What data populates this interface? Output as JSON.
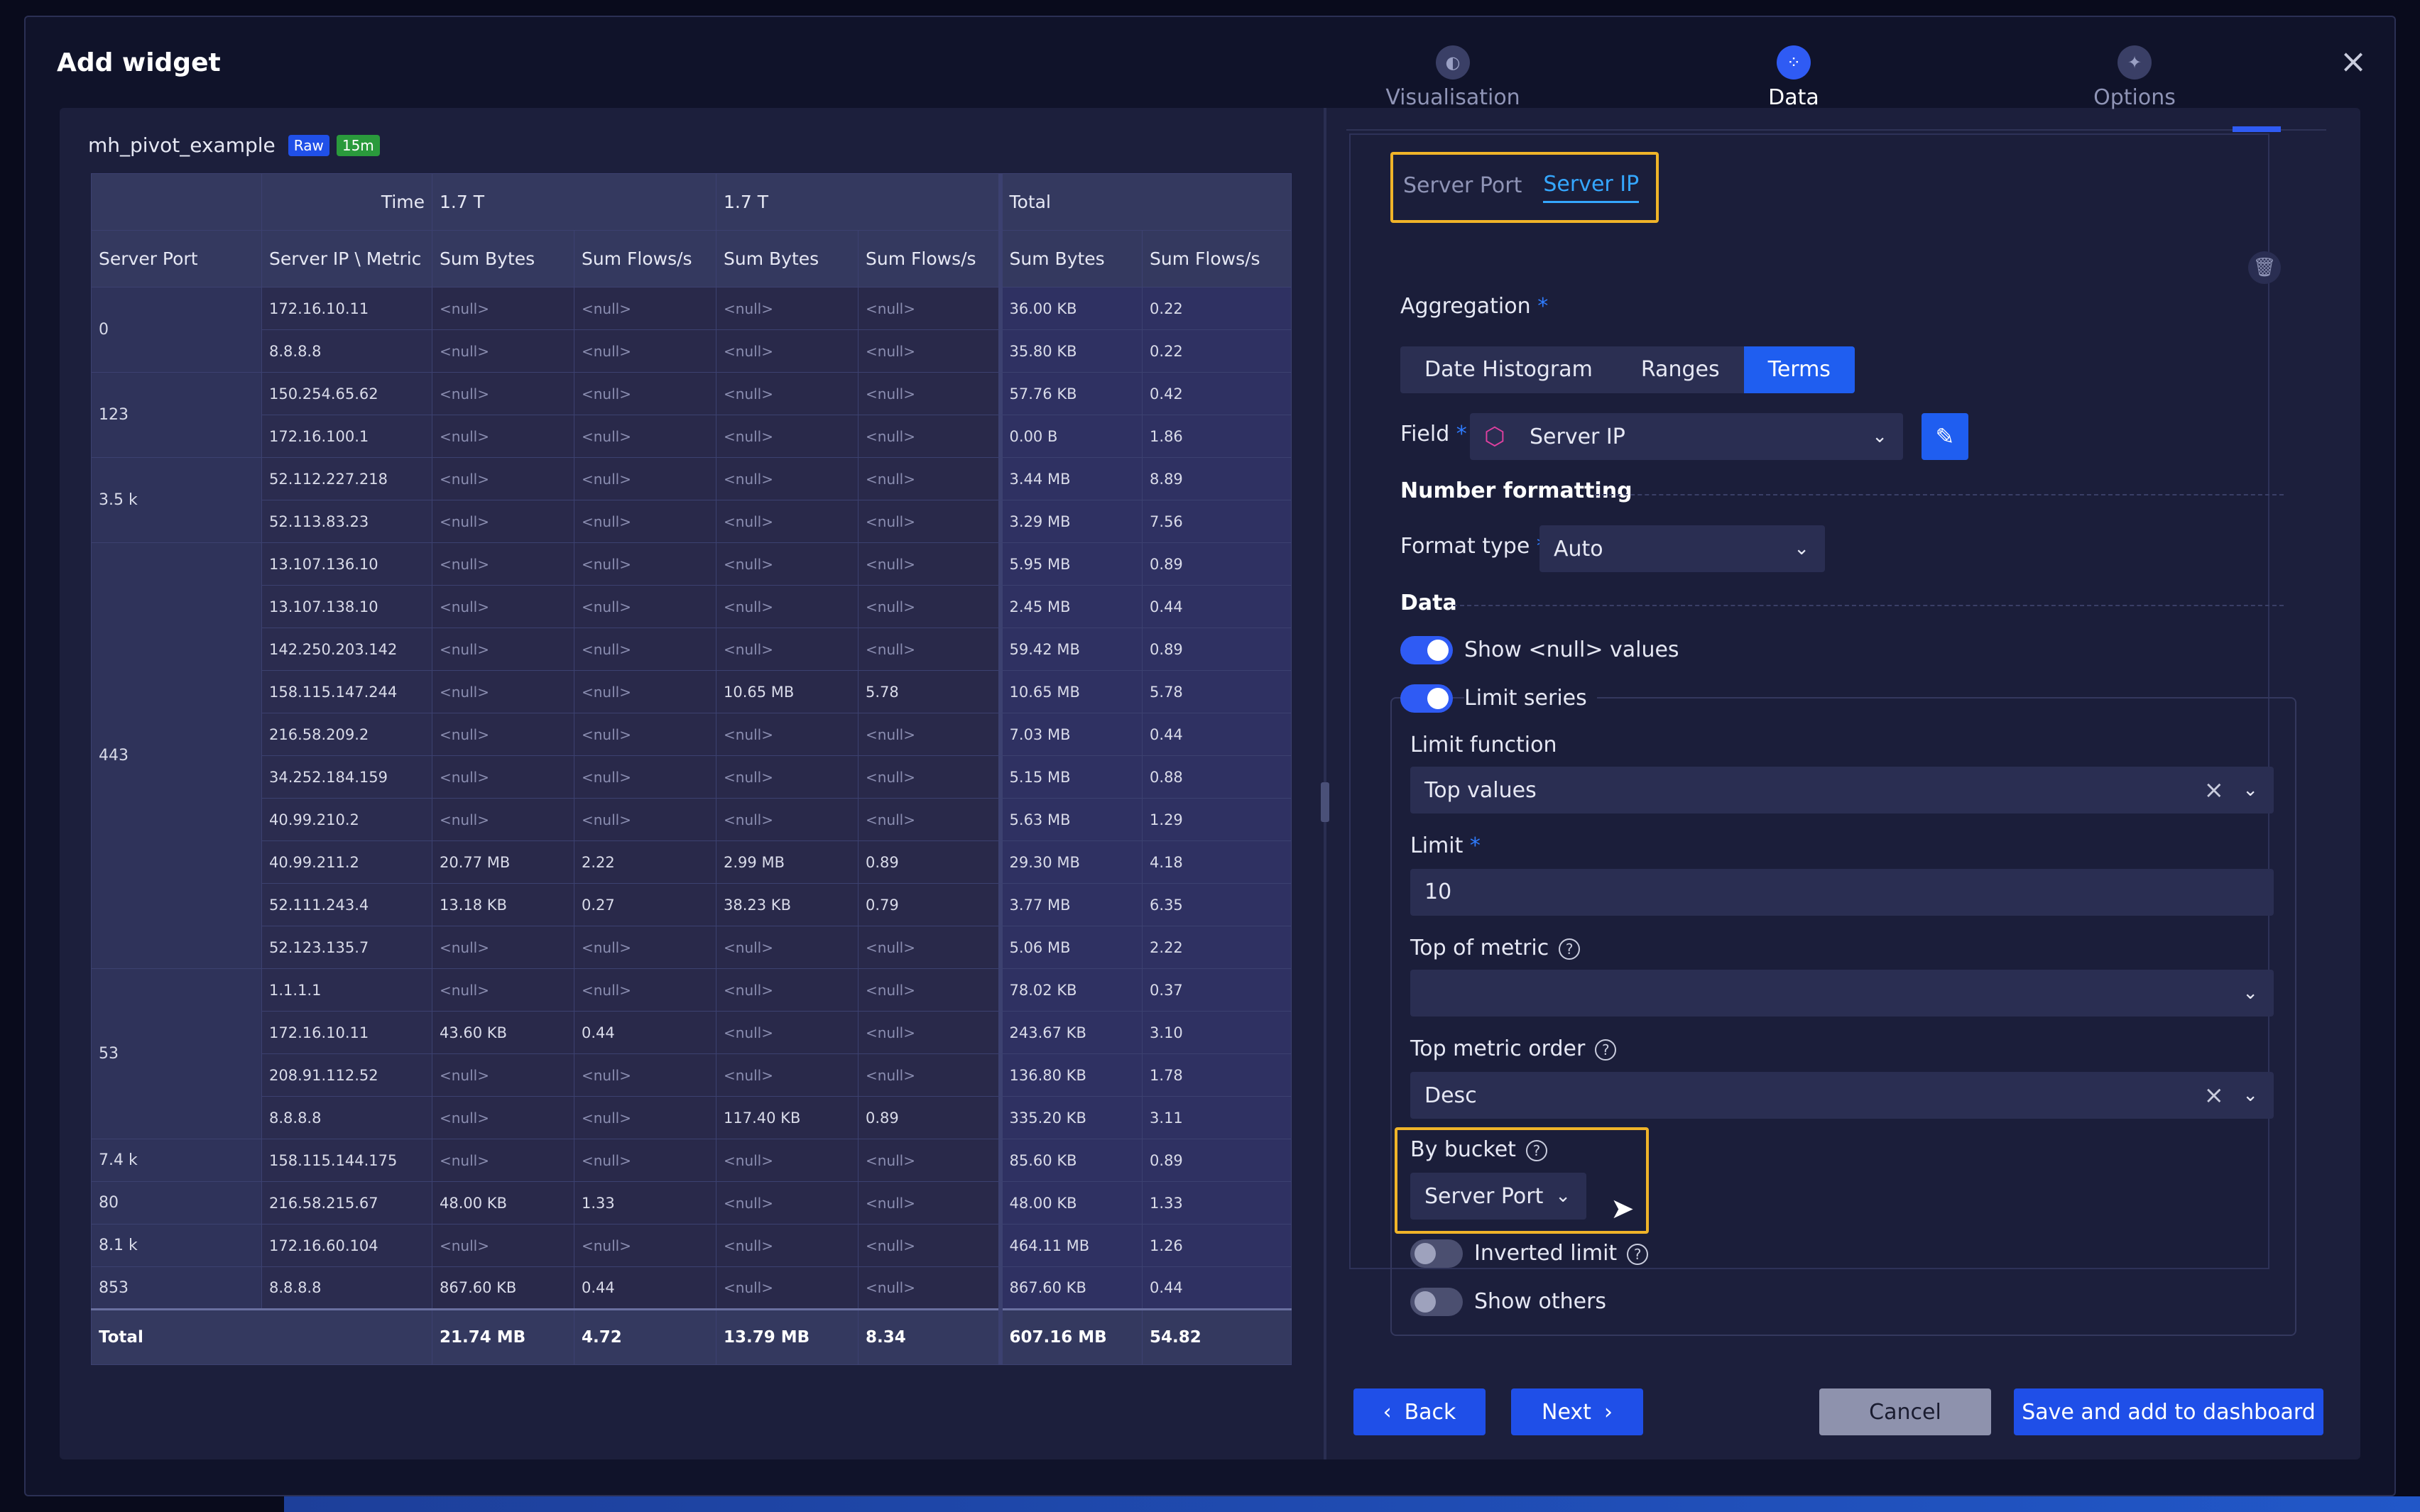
{
  "dialog": {
    "title": "Add widget",
    "close_icon": "close-icon"
  },
  "query": {
    "name": "mh_pivot_example",
    "badges": [
      "Raw",
      "15m"
    ]
  },
  "pivot": {
    "header_top": {
      "time_label": "Time",
      "groups": [
        "1.7 T",
        "1.7 T",
        "Total"
      ]
    },
    "header_cols": {
      "server_port": "Server Port",
      "server_ip_metric": "Server IP  \\  Metric",
      "metrics": [
        "Sum Bytes",
        "Sum Flows/s",
        "Sum Bytes",
        "Sum Flows/s",
        "Sum Bytes",
        "Sum Flows/s"
      ]
    },
    "groups": [
      {
        "port": "0",
        "rows": [
          {
            "ip": "172.16.10.11",
            "v": [
              "<null>",
              "<null>",
              "<null>",
              "<null>",
              "36.00 KB",
              "0.22"
            ]
          },
          {
            "ip": "8.8.8.8",
            "v": [
              "<null>",
              "<null>",
              "<null>",
              "<null>",
              "35.80 KB",
              "0.22"
            ]
          }
        ]
      },
      {
        "port": "123",
        "rows": [
          {
            "ip": "150.254.65.62",
            "v": [
              "<null>",
              "<null>",
              "<null>",
              "<null>",
              "57.76 KB",
              "0.42"
            ]
          },
          {
            "ip": "172.16.100.1",
            "v": [
              "<null>",
              "<null>",
              "<null>",
              "<null>",
              "0.00 B",
              "1.86"
            ]
          }
        ]
      },
      {
        "port": "3.5 k",
        "rows": [
          {
            "ip": "52.112.227.218",
            "v": [
              "<null>",
              "<null>",
              "<null>",
              "<null>",
              "3.44 MB",
              "8.89"
            ]
          },
          {
            "ip": "52.113.83.23",
            "v": [
              "<null>",
              "<null>",
              "<null>",
              "<null>",
              "3.29 MB",
              "7.56"
            ]
          }
        ]
      },
      {
        "port": "443",
        "rows": [
          {
            "ip": "13.107.136.10",
            "v": [
              "<null>",
              "<null>",
              "<null>",
              "<null>",
              "5.95 MB",
              "0.89"
            ]
          },
          {
            "ip": "13.107.138.10",
            "v": [
              "<null>",
              "<null>",
              "<null>",
              "<null>",
              "2.45 MB",
              "0.44"
            ]
          },
          {
            "ip": "142.250.203.142",
            "v": [
              "<null>",
              "<null>",
              "<null>",
              "<null>",
              "59.42 MB",
              "0.89"
            ]
          },
          {
            "ip": "158.115.147.244",
            "v": [
              "<null>",
              "<null>",
              "10.65 MB",
              "5.78",
              "10.65 MB",
              "5.78"
            ]
          },
          {
            "ip": "216.58.209.2",
            "v": [
              "<null>",
              "<null>",
              "<null>",
              "<null>",
              "7.03 MB",
              "0.44"
            ]
          },
          {
            "ip": "34.252.184.159",
            "v": [
              "<null>",
              "<null>",
              "<null>",
              "<null>",
              "5.15 MB",
              "0.88"
            ]
          },
          {
            "ip": "40.99.210.2",
            "v": [
              "<null>",
              "<null>",
              "<null>",
              "<null>",
              "5.63 MB",
              "1.29"
            ]
          },
          {
            "ip": "40.99.211.2",
            "v": [
              "20.77 MB",
              "2.22",
              "2.99 MB",
              "0.89",
              "29.30 MB",
              "4.18"
            ]
          },
          {
            "ip": "52.111.243.4",
            "v": [
              "13.18 KB",
              "0.27",
              "38.23 KB",
              "0.79",
              "3.77 MB",
              "6.35"
            ]
          },
          {
            "ip": "52.123.135.7",
            "v": [
              "<null>",
              "<null>",
              "<null>",
              "<null>",
              "5.06 MB",
              "2.22"
            ]
          }
        ]
      },
      {
        "port": "53",
        "rows": [
          {
            "ip": "1.1.1.1",
            "v": [
              "<null>",
              "<null>",
              "<null>",
              "<null>",
              "78.02 KB",
              "0.37"
            ]
          },
          {
            "ip": "172.16.10.11",
            "v": [
              "43.60 KB",
              "0.44",
              "<null>",
              "<null>",
              "243.67 KB",
              "3.10"
            ]
          },
          {
            "ip": "208.91.112.52",
            "v": [
              "<null>",
              "<null>",
              "<null>",
              "<null>",
              "136.80 KB",
              "1.78"
            ]
          },
          {
            "ip": "8.8.8.8",
            "v": [
              "<null>",
              "<null>",
              "117.40 KB",
              "0.89",
              "335.20 KB",
              "3.11"
            ]
          }
        ]
      },
      {
        "port": "7.4 k",
        "rows": [
          {
            "ip": "158.115.144.175",
            "v": [
              "<null>",
              "<null>",
              "<null>",
              "<null>",
              "85.60 KB",
              "0.89"
            ]
          }
        ]
      },
      {
        "port": "80",
        "rows": [
          {
            "ip": "216.58.215.67",
            "v": [
              "48.00 KB",
              "1.33",
              "<null>",
              "<null>",
              "48.00 KB",
              "1.33"
            ]
          }
        ]
      },
      {
        "port": "8.1 k",
        "rows": [
          {
            "ip": "172.16.60.104",
            "v": [
              "<null>",
              "<null>",
              "<null>",
              "<null>",
              "464.11 MB",
              "1.26"
            ]
          }
        ]
      },
      {
        "port": "853",
        "rows": [
          {
            "ip": "8.8.8.8",
            "v": [
              "867.60 KB",
              "0.44",
              "<null>",
              "<null>",
              "867.60 KB",
              "0.44"
            ]
          }
        ]
      }
    ],
    "total": {
      "label": "Total",
      "v": [
        "21.74 MB",
        "4.72",
        "13.79 MB",
        "8.34",
        "607.16 MB",
        "54.82"
      ]
    }
  },
  "wizard": {
    "tabs": [
      {
        "label": "Visualisation",
        "icon": "palette-icon"
      },
      {
        "label": "Data",
        "icon": "grid-icon"
      },
      {
        "label": "Options",
        "icon": "sparkle-icon"
      }
    ],
    "active_tab": "Data"
  },
  "bucket_chips": [
    "Server Port",
    "Server IP"
  ],
  "form": {
    "aggregation_label": "Aggregation",
    "aggregation_options": [
      "Date Histogram",
      "Ranges",
      "Terms"
    ],
    "aggregation_selected": "Terms",
    "field_label": "Field",
    "field_value": "Server IP",
    "number_formatting_title": "Number formatting",
    "format_type_label": "Format type",
    "format_type_value": "Auto",
    "data_title": "Data",
    "show_null_label": "Show <null> values",
    "show_null_on": true,
    "limit_series_label": "Limit series",
    "limit_series_on": true,
    "limit_function_label": "Limit function",
    "limit_function_value": "Top values",
    "limit_label": "Limit",
    "limit_value": "10",
    "top_of_metric_label": "Top of metric",
    "top_of_metric_value": "",
    "top_metric_order_label": "Top metric order",
    "top_metric_order_value": "Desc",
    "by_bucket_label": "By bucket",
    "by_bucket_value": "Server Port",
    "inverted_limit_label": "Inverted limit",
    "inverted_limit_on": false,
    "show_others_label": "Show others",
    "show_others_on": false
  },
  "footer": {
    "back": "Back",
    "next": "Next",
    "cancel": "Cancel",
    "save": "Save and add to dashboard"
  },
  "colors": {
    "accent": "#1f5ef0",
    "highlight": "#f0b429",
    "link": "#35a7ff"
  }
}
